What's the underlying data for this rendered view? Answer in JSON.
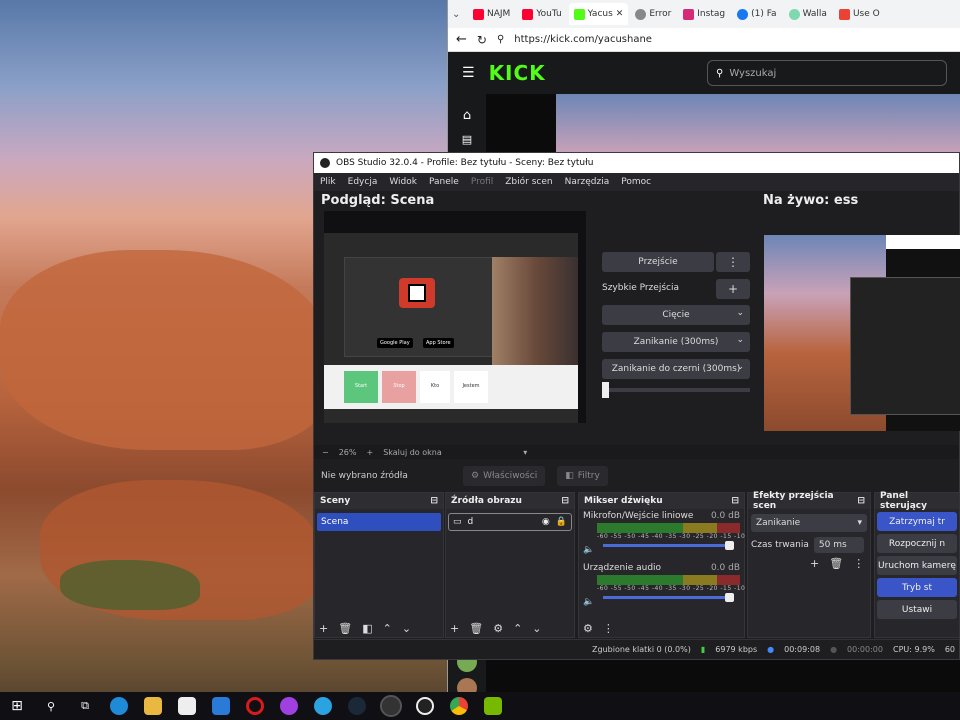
{
  "browser": {
    "tabs": [
      {
        "label": "NAJM",
        "color": "#ff0033"
      },
      {
        "label": "YouTu",
        "color": "#ff0033"
      },
      {
        "label": "Yacus",
        "color": "#53fc18",
        "active": true
      },
      {
        "label": "Error",
        "color": "#888888"
      },
      {
        "label": "Instag",
        "color": "#d62976"
      },
      {
        "label": "(1) Fa",
        "color": "#1877f2"
      },
      {
        "label": "Walla",
        "color": "#7fd8b0"
      },
      {
        "label": "Use O",
        "color": "#ea4335"
      }
    ],
    "url": "https://kick.com/yacushane",
    "kick": {
      "logo": "KICK",
      "search_placeholder": "Wyszukaj"
    }
  },
  "obs": {
    "title": "OBS Studio 32.0.4 - Profile: Bez tytułu - Sceny: Bez tytułu",
    "menu": [
      "Plik",
      "Edycja",
      "Widok",
      "Panele",
      "Profil",
      "Zbiór scen",
      "Narzędzia",
      "Pomoc"
    ],
    "preview_title": "Podgląd: Scena",
    "live_title": "Na żywo: ess",
    "transition_button": "Przejście",
    "quick_transitions_label": "Szybkie Przejścia",
    "cut_option": "Cięcie",
    "fade_option": "Zanikanie (300ms)",
    "fade_black_option": "Zanikanie do czerni (300ms)",
    "zoom_percent": "26%",
    "zoom_fit_label": "Skaluj do okna",
    "no_source_label": "Nie wybrano źródła",
    "properties_button": "Właściwości",
    "filters_button": "Filtry",
    "docks": {
      "scenes": {
        "title": "Sceny",
        "items": [
          "Scena"
        ]
      },
      "sources": {
        "title": "Źródła obrazu",
        "items": [
          "d"
        ]
      },
      "mixer": {
        "title": "Mikser dźwięku",
        "channels": [
          {
            "name": "Mikrofon/Wejście liniowe",
            "db": "0.0 dB",
            "volume": 1.0
          },
          {
            "name": "Urządzenie audio",
            "db": "0.0 dB",
            "volume": 1.0
          }
        ],
        "ticks": "-60 -55 -50 -45 -40 -35 -30 -25 -20 -15 -10 -5 0"
      },
      "transitions": {
        "title": "Efekty przejścia scen",
        "selected": "Zanikanie",
        "duration_label": "Czas trwania",
        "duration_value": "50 ms"
      },
      "controls": {
        "title": "Panel sterujący",
        "buttons": [
          "Zatrzymaj tr",
          "Rozpocznij n",
          "Uruchom kamerę",
          "Tryb st",
          "Ustawi"
        ]
      }
    },
    "status": {
      "dropped": "Zgubione klatki 0 (0.0%)",
      "bitrate": "6979 kbps",
      "stream_time": "00:09:08",
      "rec_time": "00:00:00",
      "cpu": "CPU: 9.9%",
      "fps": "60"
    },
    "preview_content": {
      "btn1": "Start",
      "btn2": "Stop",
      "btn3": "Kto",
      "btn4": "Jestem",
      "store1": "Google Play",
      "store2": "App Store"
    }
  },
  "taskbar": {
    "icons": [
      "windows-icon",
      "search-icon",
      "task-view-icon",
      "edge-icon",
      "file-explorer-icon",
      "store-icon",
      "mail-icon",
      "opera-icon",
      "messenger-icon",
      "telegram-icon",
      "steam-icon",
      "obs-icon",
      "kick-icon",
      "chrome-icon",
      "nvidia-icon"
    ]
  }
}
